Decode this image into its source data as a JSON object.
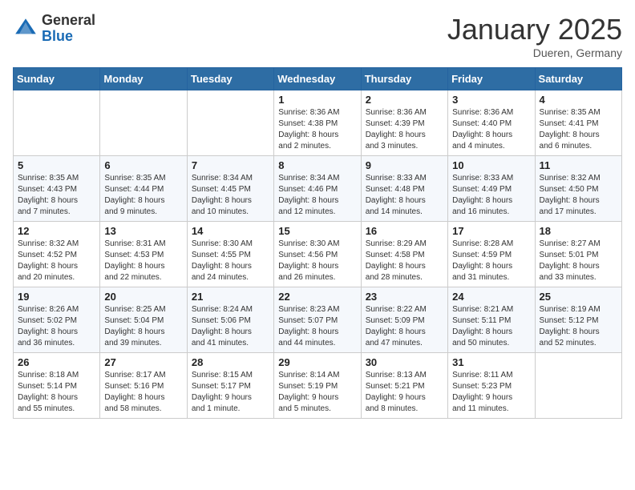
{
  "header": {
    "logo_general": "General",
    "logo_blue": "Blue",
    "month_title": "January 2025",
    "location": "Dueren, Germany"
  },
  "days_of_week": [
    "Sunday",
    "Monday",
    "Tuesday",
    "Wednesday",
    "Thursday",
    "Friday",
    "Saturday"
  ],
  "weeks": [
    [
      {
        "day": "",
        "info": ""
      },
      {
        "day": "",
        "info": ""
      },
      {
        "day": "",
        "info": ""
      },
      {
        "day": "1",
        "info": "Sunrise: 8:36 AM\nSunset: 4:38 PM\nDaylight: 8 hours\nand 2 minutes."
      },
      {
        "day": "2",
        "info": "Sunrise: 8:36 AM\nSunset: 4:39 PM\nDaylight: 8 hours\nand 3 minutes."
      },
      {
        "day": "3",
        "info": "Sunrise: 8:36 AM\nSunset: 4:40 PM\nDaylight: 8 hours\nand 4 minutes."
      },
      {
        "day": "4",
        "info": "Sunrise: 8:35 AM\nSunset: 4:41 PM\nDaylight: 8 hours\nand 6 minutes."
      }
    ],
    [
      {
        "day": "5",
        "info": "Sunrise: 8:35 AM\nSunset: 4:43 PM\nDaylight: 8 hours\nand 7 minutes."
      },
      {
        "day": "6",
        "info": "Sunrise: 8:35 AM\nSunset: 4:44 PM\nDaylight: 8 hours\nand 9 minutes."
      },
      {
        "day": "7",
        "info": "Sunrise: 8:34 AM\nSunset: 4:45 PM\nDaylight: 8 hours\nand 10 minutes."
      },
      {
        "day": "8",
        "info": "Sunrise: 8:34 AM\nSunset: 4:46 PM\nDaylight: 8 hours\nand 12 minutes."
      },
      {
        "day": "9",
        "info": "Sunrise: 8:33 AM\nSunset: 4:48 PM\nDaylight: 8 hours\nand 14 minutes."
      },
      {
        "day": "10",
        "info": "Sunrise: 8:33 AM\nSunset: 4:49 PM\nDaylight: 8 hours\nand 16 minutes."
      },
      {
        "day": "11",
        "info": "Sunrise: 8:32 AM\nSunset: 4:50 PM\nDaylight: 8 hours\nand 17 minutes."
      }
    ],
    [
      {
        "day": "12",
        "info": "Sunrise: 8:32 AM\nSunset: 4:52 PM\nDaylight: 8 hours\nand 20 minutes."
      },
      {
        "day": "13",
        "info": "Sunrise: 8:31 AM\nSunset: 4:53 PM\nDaylight: 8 hours\nand 22 minutes."
      },
      {
        "day": "14",
        "info": "Sunrise: 8:30 AM\nSunset: 4:55 PM\nDaylight: 8 hours\nand 24 minutes."
      },
      {
        "day": "15",
        "info": "Sunrise: 8:30 AM\nSunset: 4:56 PM\nDaylight: 8 hours\nand 26 minutes."
      },
      {
        "day": "16",
        "info": "Sunrise: 8:29 AM\nSunset: 4:58 PM\nDaylight: 8 hours\nand 28 minutes."
      },
      {
        "day": "17",
        "info": "Sunrise: 8:28 AM\nSunset: 4:59 PM\nDaylight: 8 hours\nand 31 minutes."
      },
      {
        "day": "18",
        "info": "Sunrise: 8:27 AM\nSunset: 5:01 PM\nDaylight: 8 hours\nand 33 minutes."
      }
    ],
    [
      {
        "day": "19",
        "info": "Sunrise: 8:26 AM\nSunset: 5:02 PM\nDaylight: 8 hours\nand 36 minutes."
      },
      {
        "day": "20",
        "info": "Sunrise: 8:25 AM\nSunset: 5:04 PM\nDaylight: 8 hours\nand 39 minutes."
      },
      {
        "day": "21",
        "info": "Sunrise: 8:24 AM\nSunset: 5:06 PM\nDaylight: 8 hours\nand 41 minutes."
      },
      {
        "day": "22",
        "info": "Sunrise: 8:23 AM\nSunset: 5:07 PM\nDaylight: 8 hours\nand 44 minutes."
      },
      {
        "day": "23",
        "info": "Sunrise: 8:22 AM\nSunset: 5:09 PM\nDaylight: 8 hours\nand 47 minutes."
      },
      {
        "day": "24",
        "info": "Sunrise: 8:21 AM\nSunset: 5:11 PM\nDaylight: 8 hours\nand 50 minutes."
      },
      {
        "day": "25",
        "info": "Sunrise: 8:19 AM\nSunset: 5:12 PM\nDaylight: 8 hours\nand 52 minutes."
      }
    ],
    [
      {
        "day": "26",
        "info": "Sunrise: 8:18 AM\nSunset: 5:14 PM\nDaylight: 8 hours\nand 55 minutes."
      },
      {
        "day": "27",
        "info": "Sunrise: 8:17 AM\nSunset: 5:16 PM\nDaylight: 8 hours\nand 58 minutes."
      },
      {
        "day": "28",
        "info": "Sunrise: 8:15 AM\nSunset: 5:17 PM\nDaylight: 9 hours\nand 1 minute."
      },
      {
        "day": "29",
        "info": "Sunrise: 8:14 AM\nSunset: 5:19 PM\nDaylight: 9 hours\nand 5 minutes."
      },
      {
        "day": "30",
        "info": "Sunrise: 8:13 AM\nSunset: 5:21 PM\nDaylight: 9 hours\nand 8 minutes."
      },
      {
        "day": "31",
        "info": "Sunrise: 8:11 AM\nSunset: 5:23 PM\nDaylight: 9 hours\nand 11 minutes."
      },
      {
        "day": "",
        "info": ""
      }
    ]
  ]
}
